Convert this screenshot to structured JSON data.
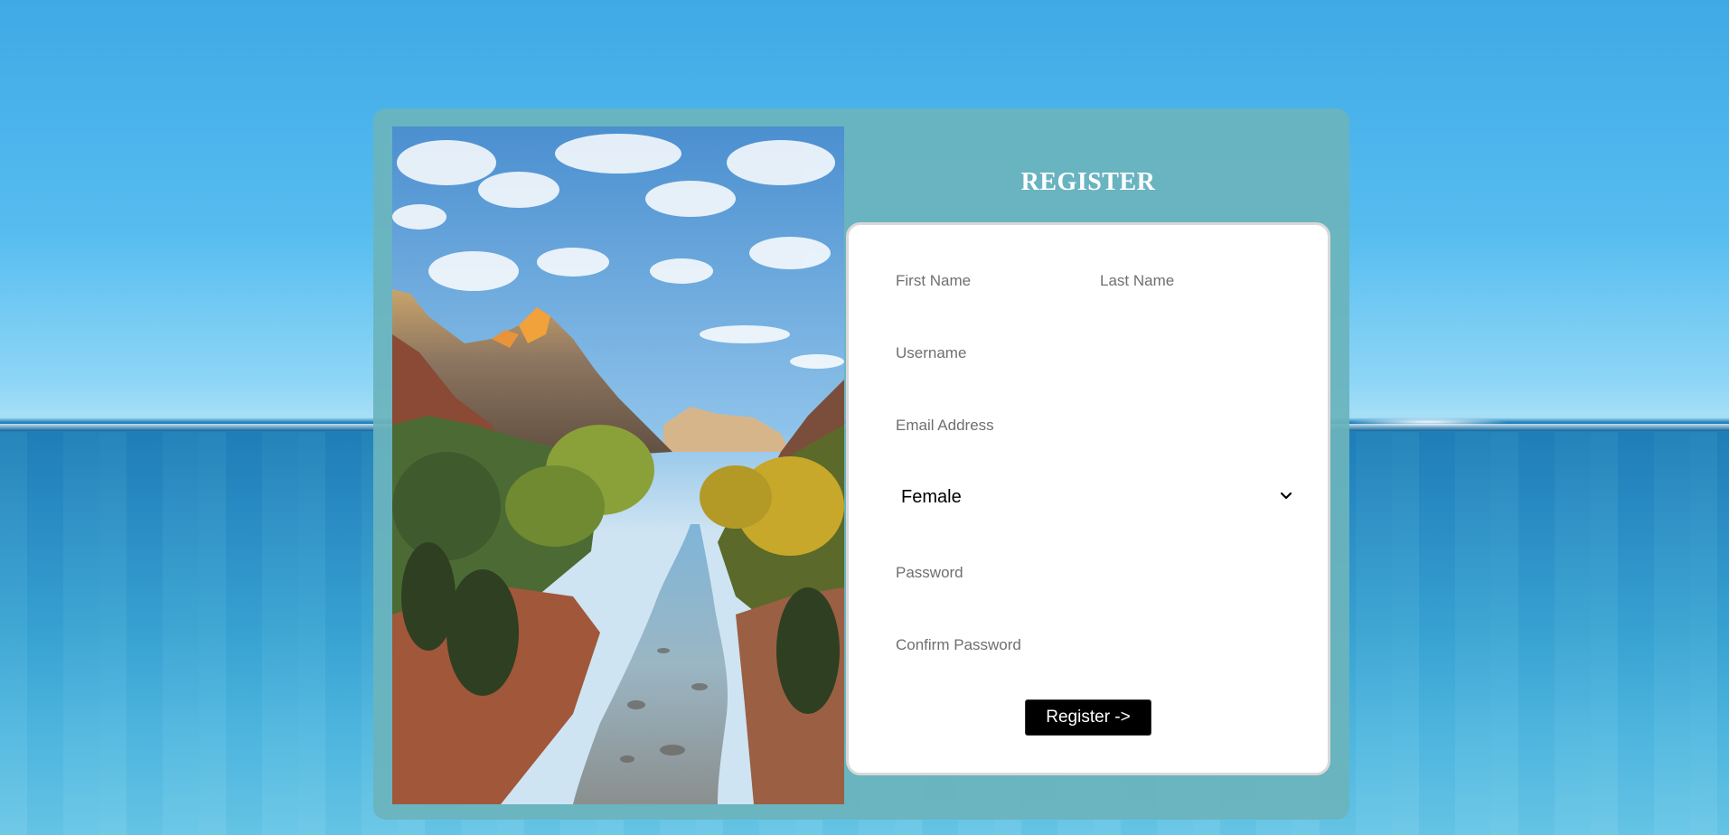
{
  "page": {
    "title": "REGISTER"
  },
  "form": {
    "first_name_placeholder": "First Name",
    "last_name_placeholder": "Last Name",
    "username_placeholder": "Username",
    "email_placeholder": "Email Address",
    "gender_selected": "Female",
    "password_placeholder": "Password",
    "confirm_password_placeholder": "Confirm Password",
    "submit_label": "Register ->"
  },
  "colors": {
    "card_background": "#6bb4bc",
    "button_background": "#000000",
    "title_color": "#ffffff"
  },
  "icons": {
    "select_arrow": "chevron-down-icon"
  }
}
